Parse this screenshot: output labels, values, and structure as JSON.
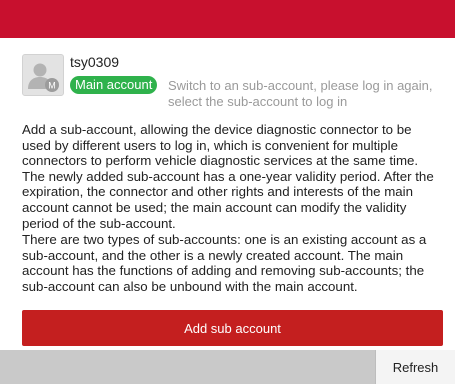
{
  "header": {
    "color": "#c8102e"
  },
  "account": {
    "avatar_icon": "user-avatar-icon",
    "avatar_badge": "M",
    "username": "tsy0309",
    "badge": "Main account",
    "badge_color": "#2fb24c",
    "switch_hint": "Switch to an sub-account, please log in again, select the sub-account to log in"
  },
  "description": {
    "p1": "Add a sub-account, allowing the device diagnostic connector to be used by different users to log in, which is convenient for multiple connectors to perform vehicle diagnostic services at the same time. The newly added sub-account has a one-year validity period. After the expiration, the connector and other rights and interests of the main account cannot be used; the main account can modify the validity period of the sub-account.",
    "p2": "There are two types of sub-accounts: one is an existing account as a sub-account, and the other is a newly created account. The main account has the functions of adding and removing sub-accounts; the sub-account can also be unbound with the main account."
  },
  "actions": {
    "add_label": "Add sub account",
    "add_color": "#c41f1f",
    "refresh_label": "Refresh"
  }
}
